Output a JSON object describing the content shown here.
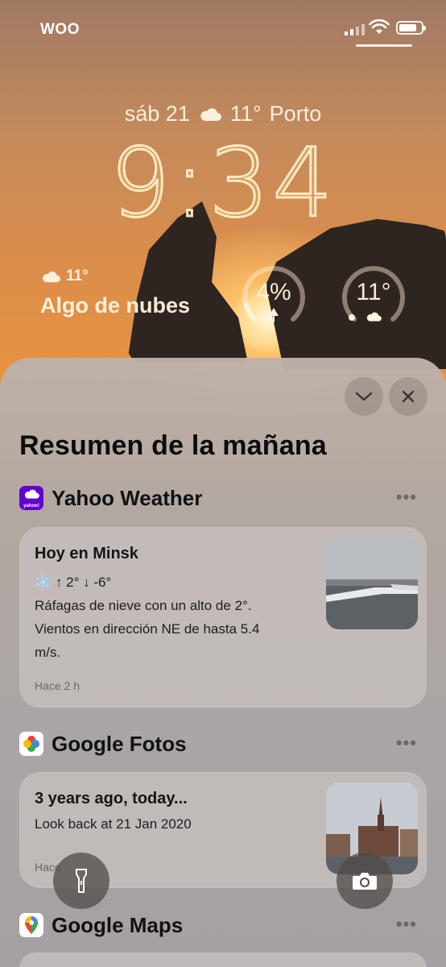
{
  "status_bar": {
    "carrier": "WOO"
  },
  "lock_screen": {
    "date_line": {
      "date": "sáb 21",
      "temperature": "11°",
      "city": "Porto"
    },
    "time": "9:34",
    "weather_widget": {
      "temperature": "11°",
      "condition": "Algo de nubes"
    },
    "ring_widgets": [
      {
        "label": "4%",
        "level": 0.04
      },
      {
        "label": "11°"
      }
    ]
  },
  "summary": {
    "title": "Resumen de la mañana",
    "sections": [
      {
        "app": "Yahoo Weather",
        "icon": "yahoo-weather-icon",
        "icon_text": "yahoo!",
        "card": {
          "title": "Hoy  en  Minsk",
          "line1": "❄️ ↑ 2° ↓ -6°",
          "line2": "Ráfagas de nieve con un alto de 2°.",
          "line3": "Vientos en dirección NE  de hasta  5.4",
          "line4": "m/s.",
          "meta": "Hace 2 h"
        }
      },
      {
        "app": "Google Fotos",
        "icon": "google-photos-icon",
        "card": {
          "title": "3 years ago, today...",
          "line1": "Look back at 21 Jan 2020",
          "meta": "Hace"
        }
      },
      {
        "app": "Google Maps",
        "icon": "google-maps-icon"
      }
    ]
  },
  "colors": {
    "yahoo_purple": "#6001d2",
    "sheet_bg": "#b4aca8",
    "wallpaper_orange": "#e9923f"
  }
}
